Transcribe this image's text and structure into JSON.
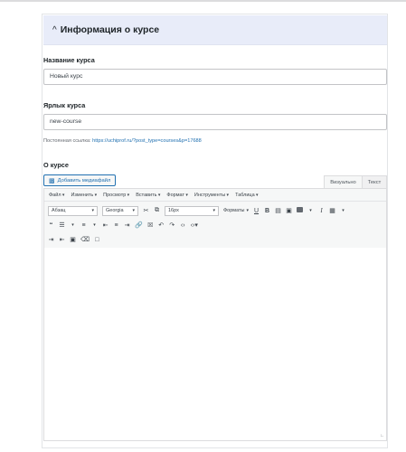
{
  "section": {
    "chevron": "^",
    "title": "Информация о курсе"
  },
  "course_name": {
    "label": "Название курса",
    "value": "Новый курс"
  },
  "course_slug": {
    "label": "Ярлык курса",
    "value": "new-course"
  },
  "permalink": {
    "prefix": "Постоянная ссылка:",
    "url": "https://uchiprof.ru/?post_type=courses&p=17688"
  },
  "about": {
    "label": "О курсе",
    "add_media": "Добавить медиафайл",
    "tab_visual": "Визуально",
    "tab_text": "Текст"
  },
  "menubar": {
    "items": [
      "Файл",
      "Изменить",
      "Просмотр",
      "Вставить",
      "Формат",
      "Инструменты",
      "Таблица"
    ]
  },
  "toolbar": {
    "paragraph": "Абзац",
    "font": "Georgia",
    "size": "16px",
    "formats": "Форматы",
    "underline": "U",
    "bold": "B",
    "italic": "I"
  },
  "icons": {
    "media": "media-icon",
    "cut": "scissors-icon",
    "copy": "copy-icon",
    "quote": "blockquote-icon",
    "link": "link-icon",
    "undo": "undo-icon",
    "redo": "redo-icon",
    "table": "table-icon",
    "read_more": "bookmark-icon"
  }
}
